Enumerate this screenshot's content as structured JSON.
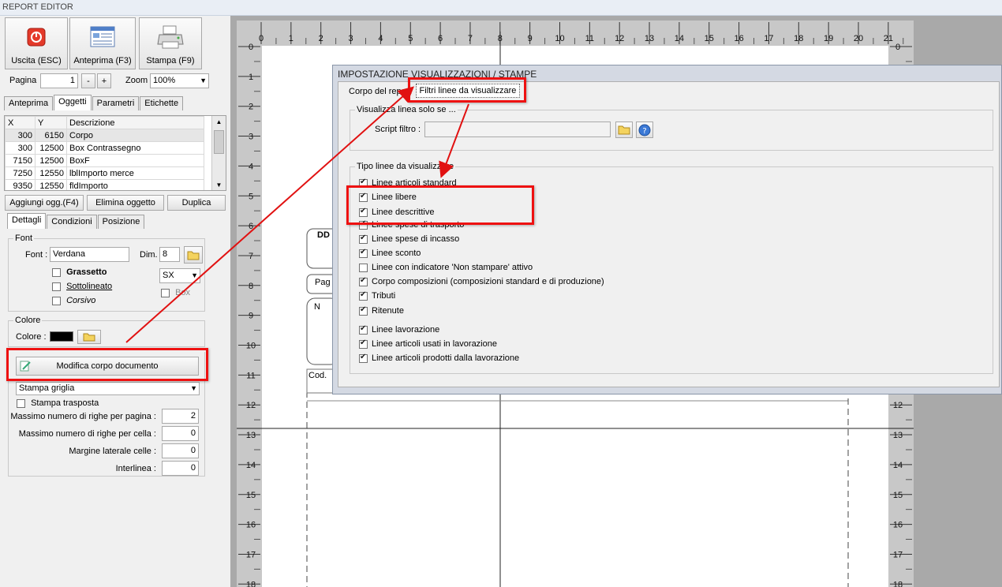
{
  "window": {
    "title": "REPORT EDITOR"
  },
  "toolbar": {
    "exit_label": "Uscita (ESC)",
    "preview_label": "Anteprima (F3)",
    "print_label": "Stampa (F9)",
    "page_label": "Pagina",
    "page_value": "1",
    "minus_label": "-",
    "plus_label": "+",
    "zoom_label": "Zoom",
    "zoom_value": "100%"
  },
  "top_tabs": [
    "Anteprima",
    "Oggetti",
    "Parametri",
    "Etichette"
  ],
  "objects_table": {
    "headers": [
      "X",
      "Y",
      "Descrizione"
    ],
    "rows": [
      [
        "300",
        "6150",
        "Corpo"
      ],
      [
        "300",
        "12500",
        "Box Contrassegno"
      ],
      [
        "7150",
        "12500",
        "BoxF"
      ],
      [
        "7250",
        "12550",
        "lblImporto merce"
      ],
      [
        "9350",
        "12550",
        "fldImporto"
      ]
    ]
  },
  "object_buttons": {
    "add": "Aggiungi ogg.(F4)",
    "delete": "Elimina oggetto",
    "duplicate": "Duplica"
  },
  "detail_tabs": [
    "Dettagli",
    "Condizioni",
    "Posizione"
  ],
  "font_group": {
    "title": "Font",
    "font_label": "Font :",
    "font_value": "Verdana",
    "dim_label": "Dim.",
    "dim_value": "8",
    "bold": "Grassetto",
    "underline": "Sottolineato",
    "italic": "Corsivo",
    "align_value": "SX",
    "box": "Box"
  },
  "color_group": {
    "title": "Colore",
    "color_label": "Colore :",
    "color_value": "#000000"
  },
  "body_group": {
    "edit_button": "Modifica corpo documento",
    "print_mode": "Stampa griglia",
    "transposed": "Stampa trasposta",
    "fields": [
      {
        "label": "Massimo numero di righe per pagina :",
        "value": "2"
      },
      {
        "label": "Massimo numero di righe per cella :",
        "value": "0"
      },
      {
        "label": "Margine laterale celle :",
        "value": "0"
      },
      {
        "label": "Interlinea :",
        "value": "0"
      }
    ]
  },
  "ruler": {
    "h_numbers": [
      "0",
      "1",
      "2",
      "3",
      "4",
      "5",
      "6",
      "7",
      "8",
      "9",
      "10",
      "11",
      "12",
      "13",
      "14",
      "15",
      "16",
      "17",
      "18",
      "19",
      "20",
      "21"
    ],
    "v_numbers": [
      "0",
      "1",
      "2",
      "3",
      "4",
      "5",
      "6",
      "7",
      "8",
      "9",
      "10",
      "11",
      "12",
      "13",
      "14",
      "15",
      "16",
      "17",
      "18"
    ]
  },
  "canvas_fragments": {
    "dd": "DD",
    "pag": "Pag",
    "n": "N",
    "cod": "Cod."
  },
  "dialog": {
    "title": "IMPOSTAZIONE VISUALIZZAZIONI / STAMPE",
    "tabs": [
      "Corpo del report",
      "Filtri linee da visualizzare"
    ],
    "filter_group_title": "Visualizza linea solo se ...",
    "script_label": "Script filtro :",
    "script_value": "",
    "types_group_title": "Tipo linee da visualizzare",
    "options": [
      {
        "label": "Linee articoli standard",
        "checked": true
      },
      {
        "label": "Linee libere",
        "checked": true
      },
      {
        "label": "Linee descrittive",
        "checked": true
      },
      {
        "label": "Linee spese di trasporto",
        "checked": true
      },
      {
        "label": "Linee spese di incasso",
        "checked": true
      },
      {
        "label": "Linee sconto",
        "checked": true
      },
      {
        "label": "Linee con indicatore 'Non stampare' attivo",
        "checked": false
      },
      {
        "label": "Corpo composizioni (composizioni standard e di produzione)",
        "checked": true
      },
      {
        "label": "Tributi",
        "checked": true
      },
      {
        "label": "Ritenute",
        "checked": true
      },
      {
        "label": "Linee lavorazione",
        "checked": true
      },
      {
        "label": "Linee articoli usati in lavorazione",
        "checked": true
      },
      {
        "label": "Linee articoli prodotti dalla lavorazione",
        "checked": true
      }
    ]
  },
  "colors": {
    "highlight": "#e11111",
    "arrow": "#e11111"
  }
}
